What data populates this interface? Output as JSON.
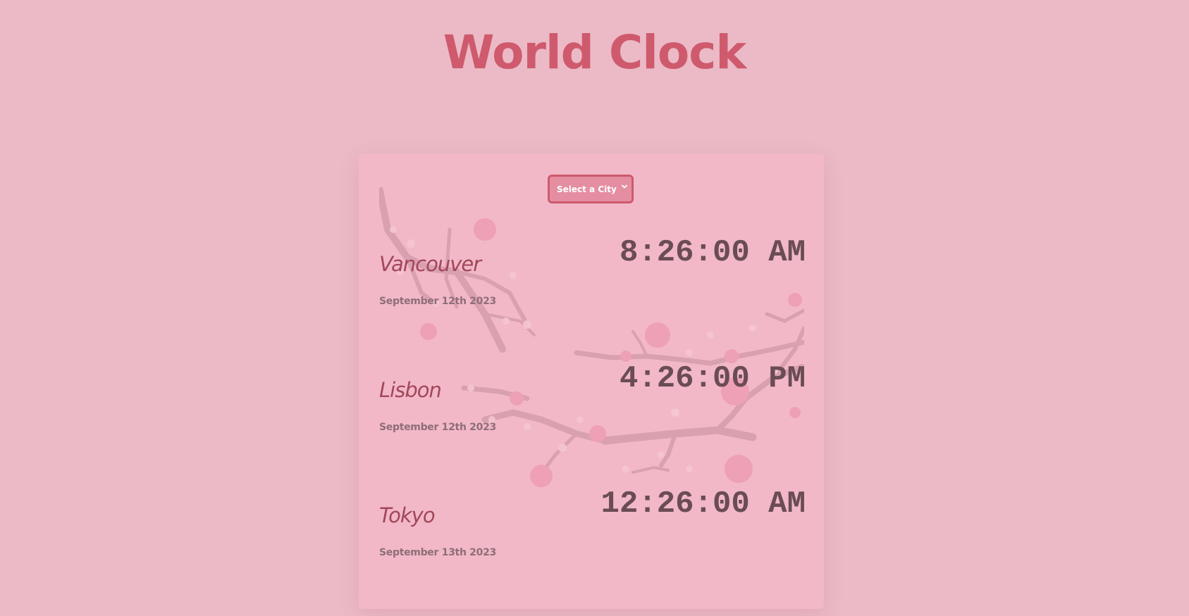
{
  "page": {
    "title": "World Clock"
  },
  "selector": {
    "selected_label": "Select a City",
    "icon": "chevron-down-icon"
  },
  "cities": [
    {
      "name": "Vancouver",
      "date": "September 12th 2023",
      "time": "8:26:00 AM"
    },
    {
      "name": "Lisbon",
      "date": "September 12th 2023",
      "time": "4:26:00 PM"
    },
    {
      "name": "Tokyo",
      "date": "September 13th 2023",
      "time": "12:26:00 AM"
    }
  ],
  "colors": {
    "background": "#ebbac6",
    "card": "#f2b8c8",
    "accent": "#cf5a6d",
    "city_name": "#a2475a",
    "time": "#6a4c55",
    "date": "#8e6e77"
  }
}
